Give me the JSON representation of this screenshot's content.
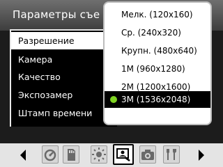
{
  "header": {
    "title": "Параметры съе"
  },
  "menu": {
    "items": [
      {
        "label": "Разрешение",
        "selected": true
      },
      {
        "label": "Камера",
        "selected": false
      },
      {
        "label": "Качество",
        "selected": false
      },
      {
        "label": "Экспозамер",
        "selected": false
      },
      {
        "label": "Штамп времени",
        "selected": false
      }
    ]
  },
  "dropdown": {
    "options": [
      {
        "label": "Мелк. (120x160)",
        "selected": false
      },
      {
        "label": "Ср. (240x320)",
        "selected": false
      },
      {
        "label": "Крупн. (480x640)",
        "selected": false
      },
      {
        "label": "1M (960x1280)",
        "selected": false
      },
      {
        "label": "2M (1200x1600)",
        "selected": false
      },
      {
        "label": "3M (1536x2048)",
        "selected": true
      }
    ]
  },
  "toolbar": {
    "icons": [
      "timer-icon",
      "memory-card-icon",
      "brightness-icon",
      "photo-settings-icon",
      "camera-icon",
      "tools-icon"
    ],
    "active": "photo-settings-icon"
  },
  "colors": {
    "radio_selected": "#7ed321",
    "selection_bg": "#000000",
    "menu_selected_bg": "#ffffff"
  }
}
